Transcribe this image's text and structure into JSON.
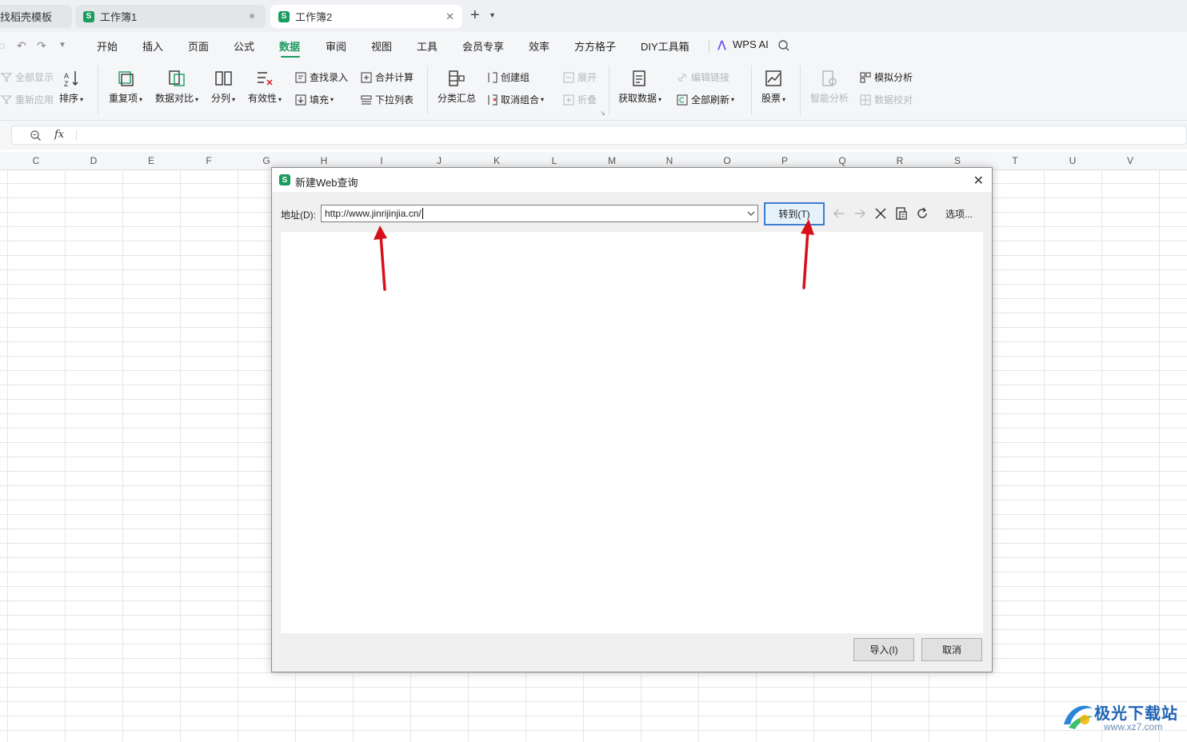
{
  "tabs": [
    {
      "label": "找稻壳模板",
      "active": false
    },
    {
      "label": "工作簿1",
      "active": false
    },
    {
      "label": "工作簿2",
      "active": true
    }
  ],
  "menu": {
    "items": [
      "开始",
      "插入",
      "页面",
      "公式",
      "数据",
      "审阅",
      "视图",
      "工具",
      "会员专享",
      "效率",
      "方方格子",
      "DIY工具箱"
    ],
    "active": "数据",
    "wps_ai": "WPS AI"
  },
  "ribbon": {
    "show_all": "全部显示",
    "reapply": "重新应用",
    "sort": "排序",
    "duplicates": "重复项",
    "compare": "数据对比",
    "split": "分列",
    "validity": "有效性",
    "lookup_entry": "查找录入",
    "fill": "填充",
    "consolidate": "合并计算",
    "dropdown_list": "下拉列表",
    "subtotal": "分类汇总",
    "create_group": "创建组",
    "ungroup": "取消组合",
    "expand": "展开",
    "collapse": "折叠",
    "get_data": "获取数据",
    "edit_links": "编辑链接",
    "refresh_all": "全部刷新",
    "stocks": "股票",
    "smart_analysis": "智能分析",
    "what_if": "模拟分析",
    "data_check": "数据校对"
  },
  "formula": {
    "fx": "fx"
  },
  "columns": [
    "C",
    "D",
    "E",
    "F",
    "G",
    "H",
    "I",
    "J",
    "K",
    "L",
    "M",
    "N",
    "O",
    "P",
    "Q",
    "R",
    "S",
    "T",
    "U",
    "V"
  ],
  "dialog": {
    "title": "新建Web查询",
    "address_label": "地址(D):",
    "address_value": "http://www.jinrijinjia.cn/",
    "go_button": "转到(T)",
    "options": "选项...",
    "import_button": "导入(I)",
    "cancel_button": "取消"
  },
  "watermark": {
    "brand": "极光下载站",
    "url": "www.xz7.com"
  },
  "colors": {
    "accent": "#1a9c5e",
    "arrow": "#d6111a",
    "focus": "#3b7ed2"
  }
}
